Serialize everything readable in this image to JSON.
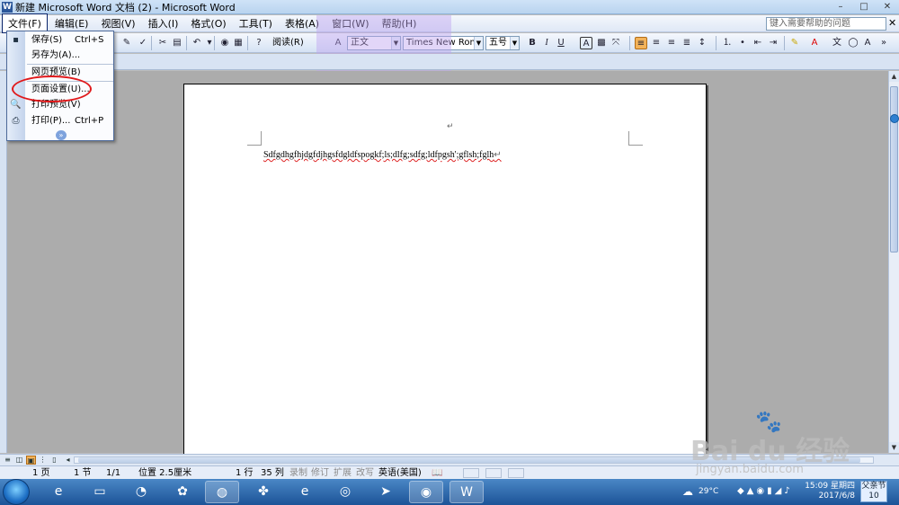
{
  "window": {
    "title": "新建 Microsoft Word 文档 (2) - Microsoft Word",
    "controls": [
      "–",
      "□",
      "✕"
    ]
  },
  "menubar": {
    "items": [
      "文件(F)",
      "编辑(E)",
      "视图(V)",
      "插入(I)",
      "格式(O)",
      "工具(T)",
      "表格(A)",
      "窗口(W)",
      "帮助(H)"
    ],
    "help_placeholder": "键入需要帮助的问题",
    "help_close": "✕"
  },
  "toolbar": {
    "reading_label": "阅读(R)",
    "style_value": "正文",
    "font_value": "Times New Roman",
    "size_value": "五号",
    "bold": "B",
    "italic": "I",
    "underline": "U",
    "font_color": "A",
    "char_scale": "A"
  },
  "file_menu": {
    "items": [
      {
        "label": "保存(S)",
        "shortcut": "Ctrl+S",
        "icon": "save-icon"
      },
      {
        "label": "另存为(A)...",
        "shortcut": "",
        "icon": ""
      },
      {
        "label": "网页预览(B)",
        "shortcut": "",
        "icon": ""
      },
      {
        "label": "页面设置(U)...",
        "shortcut": "",
        "icon": ""
      },
      {
        "label": "打印预览(V)",
        "shortcut": "",
        "icon": "print-preview-icon"
      },
      {
        "label": "打印(P)...",
        "shortcut": "Ctrl+P",
        "icon": "print-icon"
      }
    ],
    "expand_glyph": "»"
  },
  "document": {
    "body_text": "Sdfgdhgfhjdgfdjhgsfdgldfspogkf;ls;dlfg;sdfg;ldfpgsh';gflsh;fglh",
    "para_mark": "↵"
  },
  "statusbar": {
    "page": "1 页",
    "section": "1 节",
    "page_of": "1/1",
    "position": "位置 2.5厘米",
    "line": "1 行",
    "column": "35 列",
    "rec": "录制",
    "trk": "修订",
    "ext": "扩展",
    "ovr": "改写",
    "language": "英语(美国)"
  },
  "taskbar": {
    "temperature": "29°C",
    "time": "15:09 星期四",
    "date": "2017/6/8",
    "festival_label": "父亲节",
    "festival_day": "10"
  },
  "watermark": {
    "brand": "Bai du 经验",
    "site": "jingyan.baidu.com"
  },
  "colors": {
    "title_bg": "#cfe3f7",
    "menu_active_border": "#0a246a",
    "annotation_red": "#e0191b",
    "taskbar_blue": "#1c5397"
  }
}
